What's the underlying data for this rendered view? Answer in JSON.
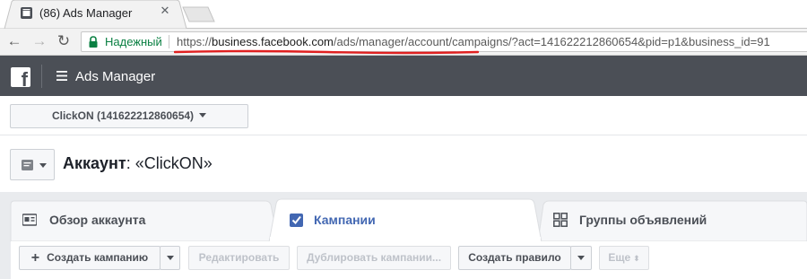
{
  "browser": {
    "tab_title": "(86) Ads Manager",
    "secure_label": "Надежный",
    "url_scheme": "https://",
    "url_host": "business.facebook.com",
    "url_path": "/ads/manager/account/campaigns/?act=141622212860654&pid=p1&business_id=91"
  },
  "app": {
    "title": "Ads Manager",
    "logo_letter": "f"
  },
  "account": {
    "selector_label": "ClickON (141622212860654)",
    "heading_key": "Аккаунт",
    "heading_value": ": «ClickON»"
  },
  "tabs": [
    {
      "label": "Обзор аккаунта",
      "icon": "overview-icon",
      "active": false
    },
    {
      "label": "Кампании",
      "icon": "checkbox-checked-icon",
      "active": true
    },
    {
      "label": "Группы объявлений",
      "icon": "grid-icon",
      "active": false
    }
  ],
  "actions": {
    "create_campaign": "Создать кампанию",
    "edit": "Редактировать",
    "duplicate": "Дублировать кампании...",
    "create_rule": "Создать правило",
    "more": "Еще",
    "more_glyph": "⬍"
  },
  "colors": {
    "fb_bar": "#4b4f56",
    "active_tab": "#4267b2",
    "secure": "#0b8043",
    "url_underline": "#e02020"
  }
}
